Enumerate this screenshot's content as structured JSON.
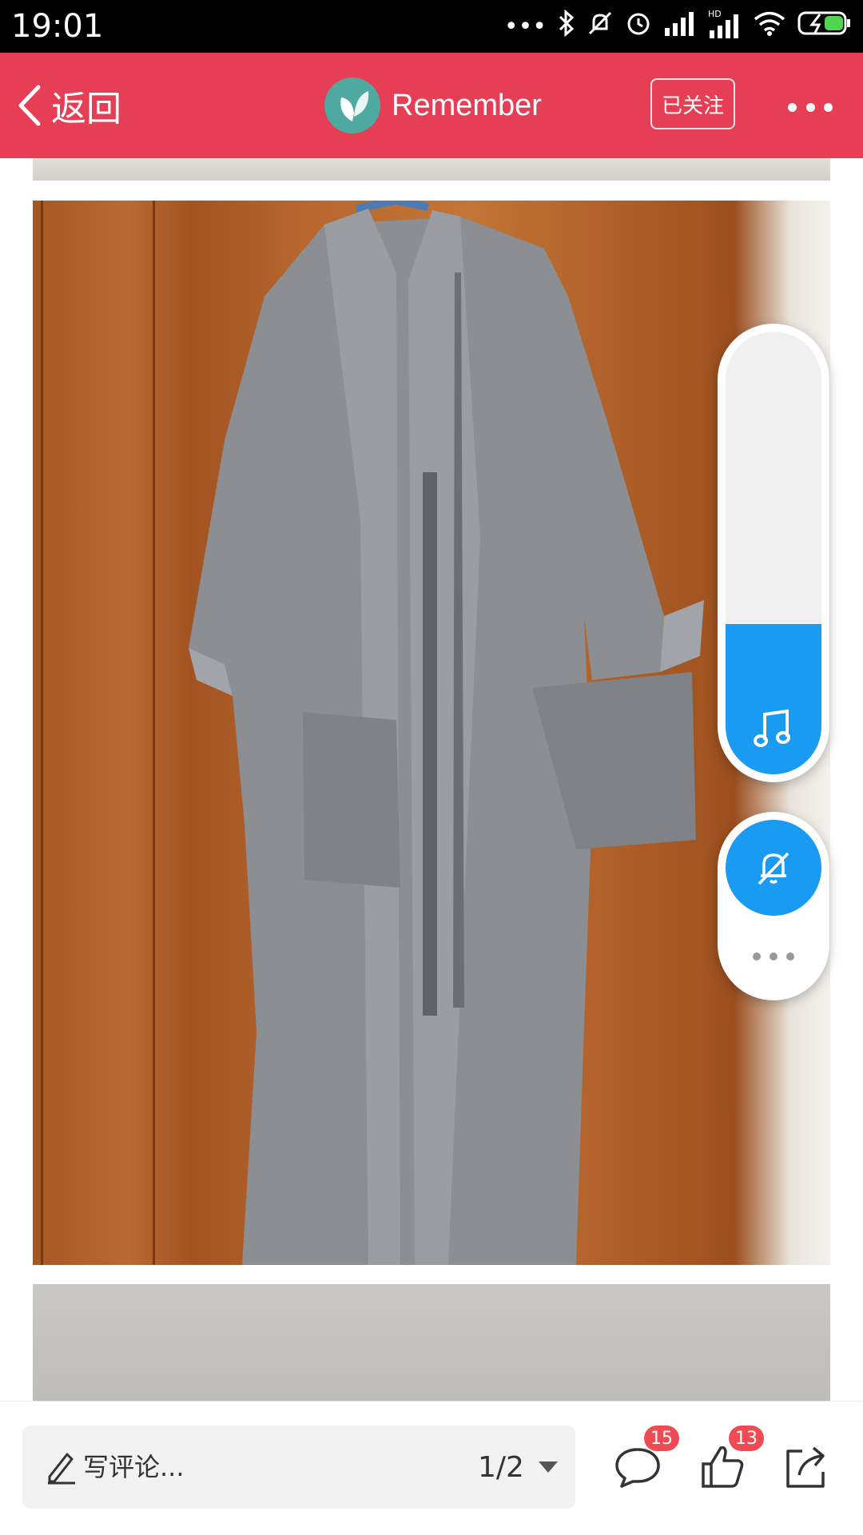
{
  "status_bar": {
    "time": "19:01",
    "icons": [
      "more-dots-icon",
      "bluetooth-icon",
      "alarm-off-icon",
      "alarm-clock-icon",
      "signal-icon",
      "hd-signal-icon",
      "wifi-icon",
      "battery-charging-icon"
    ]
  },
  "header": {
    "back_label": "返回",
    "profile_name": "Remember",
    "follow_label": "已关注",
    "bg_color": "#e63e54"
  },
  "widgets": {
    "music_level": 0.34,
    "accent_color": "#1a9bf3"
  },
  "bottom_bar": {
    "comment_placeholder": "写评论...",
    "page_indicator": "1/2",
    "comments_count": "15",
    "likes_count": "13"
  }
}
